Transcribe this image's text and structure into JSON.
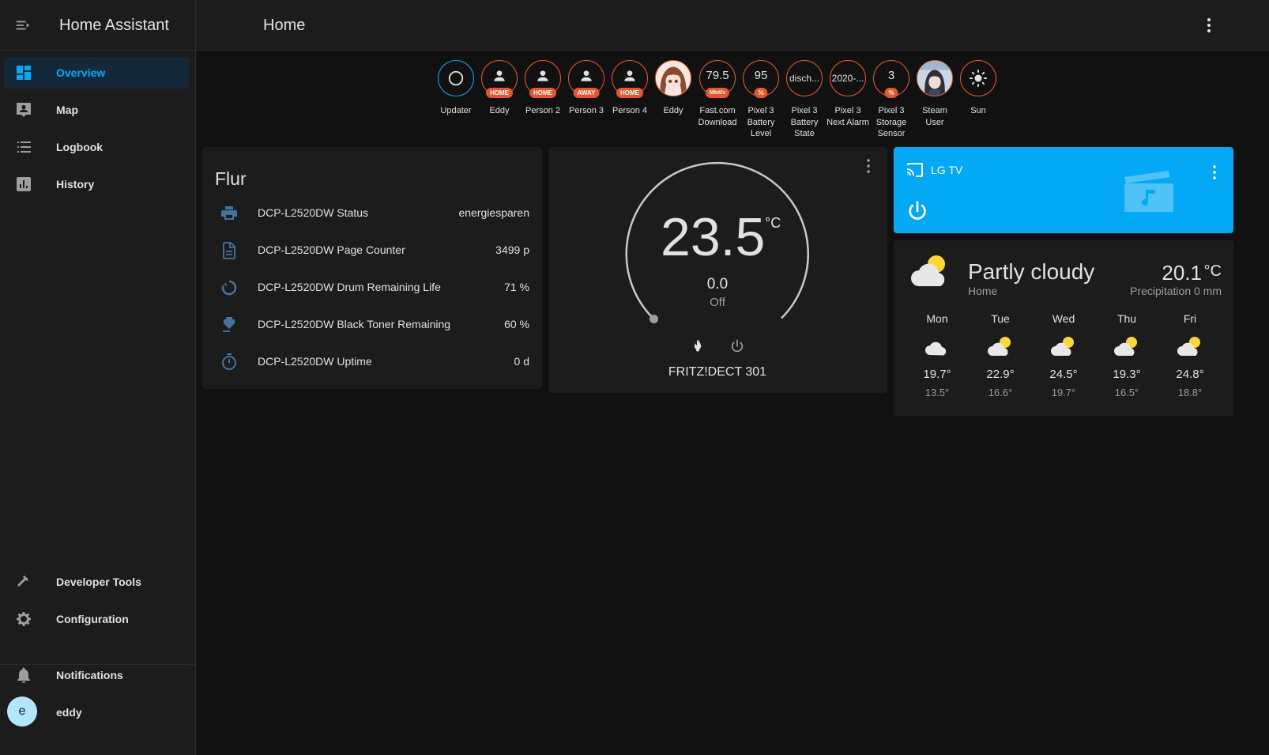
{
  "app": {
    "title": "Home Assistant"
  },
  "page": {
    "title": "Home"
  },
  "sidebar": {
    "items": [
      {
        "label": "Overview",
        "icon": "view-dashboard-icon",
        "active": true
      },
      {
        "label": "Map",
        "icon": "account-box-icon"
      },
      {
        "label": "Logbook",
        "icon": "format-list-bulleted-icon"
      },
      {
        "label": "History",
        "icon": "chart-box-icon"
      }
    ],
    "bottom_items": [
      {
        "label": "Developer Tools",
        "icon": "hammer-icon"
      },
      {
        "label": "Configuration",
        "icon": "cog-icon"
      }
    ],
    "notifications_label": "Notifications",
    "user": {
      "initial": "e",
      "name": "eddy"
    }
  },
  "badges": [
    {
      "name": "Updater",
      "type": "icon",
      "icon": "updater-ring-icon",
      "border": "#03a9f4"
    },
    {
      "name": "Eddy",
      "type": "person",
      "pill": "HOME"
    },
    {
      "name": "Person 2",
      "type": "person",
      "pill": "HOME"
    },
    {
      "name": "Person 3",
      "type": "person",
      "pill": "AWAY"
    },
    {
      "name": "Person 4",
      "type": "person",
      "pill": "HOME"
    },
    {
      "name": "Eddy",
      "type": "picture",
      "avatar": "anime-girl-avatar"
    },
    {
      "name": "Fast.com Download",
      "type": "value",
      "value": "79.5",
      "pill": "Mbit/s"
    },
    {
      "name": "Pixel 3 Battery Level",
      "type": "value",
      "value": "95",
      "pill": "%"
    },
    {
      "name": "Pixel 3 Battery State",
      "type": "value",
      "value": "disch...",
      "small": true
    },
    {
      "name": "Pixel 3 Next Alarm",
      "type": "value",
      "value": "2020-...",
      "small": true
    },
    {
      "name": "Pixel 3 Storage Sensor",
      "type": "value",
      "value": "3",
      "pill": "%"
    },
    {
      "name": "Steam User",
      "type": "picture",
      "avatar": "anime-boy-avatar"
    },
    {
      "name": "Sun",
      "type": "icon",
      "icon": "sun-icon"
    }
  ],
  "entities_card": {
    "title": "Flur",
    "rows": [
      {
        "name": "DCP-L2520DW Status",
        "value": "energiesparen",
        "icon": "printer-icon"
      },
      {
        "name": "DCP-L2520DW Page Counter",
        "value": "3499 p",
        "icon": "file-document-icon"
      },
      {
        "name": "DCP-L2520DW Drum Remaining Life",
        "value": "71 %",
        "icon": "drum-ring-icon"
      },
      {
        "name": "DCP-L2520DW Black Toner Remaining",
        "value": "60 %",
        "icon": "toner-icon"
      },
      {
        "name": "DCP-L2520DW Uptime",
        "value": "0 d",
        "icon": "timer-icon"
      }
    ]
  },
  "thermostat": {
    "current_temp": "23.5",
    "unit": "°C",
    "target": "0.0",
    "mode": "Off",
    "name": "FRITZ!DECT 301",
    "mode_icons": [
      "fire-icon",
      "power-icon"
    ]
  },
  "media_card": {
    "name": "LG TV",
    "background": "#03a9f4",
    "icons": [
      "cast-icon",
      "power-icon",
      "movie-music-icon",
      "more-vert-icon"
    ]
  },
  "weather": {
    "condition": "Partly cloudy",
    "location": "Home",
    "temperature": "20.1",
    "unit": "°C",
    "precipitation": "Precipitation 0 mm",
    "forecast": [
      {
        "day": "Mon",
        "icon": "cloudy-icon",
        "high": "19.7°",
        "low": "13.5°"
      },
      {
        "day": "Tue",
        "icon": "partly-cloudy-icon",
        "high": "22.9°",
        "low": "16.6°"
      },
      {
        "day": "Wed",
        "icon": "partly-cloudy-icon",
        "high": "24.5°",
        "low": "19.7°"
      },
      {
        "day": "Thu",
        "icon": "partly-cloudy-icon",
        "high": "19.3°",
        "low": "16.5°"
      },
      {
        "day": "Fri",
        "icon": "partly-cloudy-icon",
        "high": "24.8°",
        "low": "18.8°"
      }
    ]
  }
}
